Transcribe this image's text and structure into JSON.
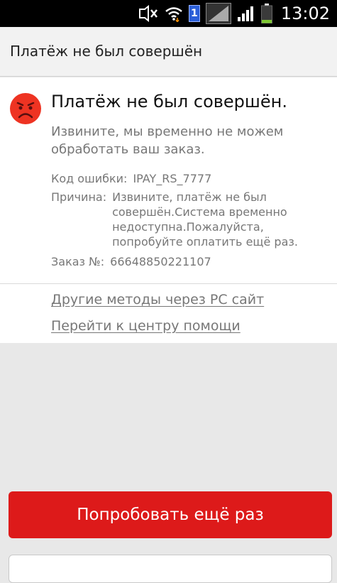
{
  "status_bar": {
    "time": "13:02",
    "sim_number": "1",
    "icons": [
      "mute-icon",
      "wifi-icon",
      "sim-icon",
      "signal-icon",
      "signal-icon",
      "battery-icon"
    ]
  },
  "header": {
    "title": "Платёж не был совершён"
  },
  "error": {
    "title": "Платёж не был совершён.",
    "subtitle": "Извините, мы временно не можем обработать ваш заказ.",
    "code_label": "Код ошибки:",
    "code_value": "IPAY_RS_7777",
    "reason_label": "Причина:",
    "reason_value": "Извините, платёж не был совершён.Система временно недоступна.Пожалуйста, попробуйте оплатить ещё раз.",
    "order_label": "Заказ №:",
    "order_value": "66648850221107",
    "icon": "sad-face-icon"
  },
  "links": {
    "pc_site": "Другие методы через PC сайт",
    "help_center": "Перейти к центру помощи"
  },
  "actions": {
    "retry_label": "Попробовать ещё раз"
  },
  "colors": {
    "accent": "#dd1a1a",
    "sad_face": "#ee3322",
    "status_bar": "#000000"
  }
}
